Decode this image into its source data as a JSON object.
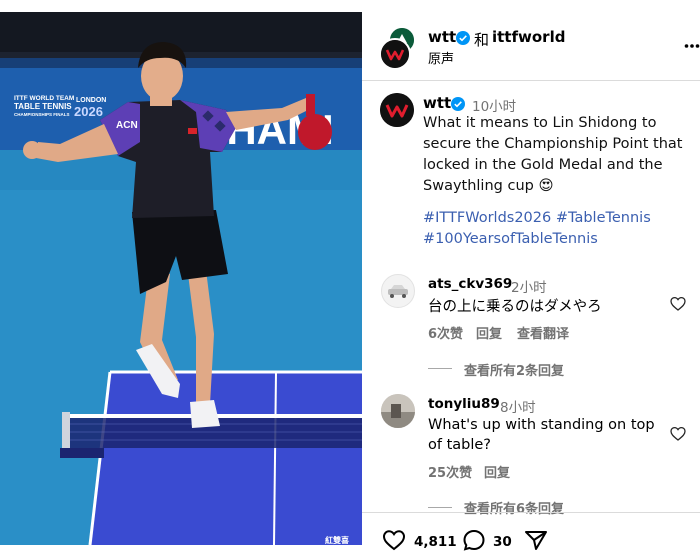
{
  "photo": {
    "banner_small_text": "ITTF WORLD TEAM\nTABLE TENNIS\nCHAMPIONSHIPS FINALS",
    "banner_city": "LONDON",
    "banner_year": "2026",
    "banner_big_text": "CHAMI",
    "shirt_text": "ACN",
    "sponsor_text": "紅雙喜"
  },
  "header": {
    "account": "wtt",
    "coauthor_joiner": "和",
    "coauthor": "ittfworld",
    "audio_label": "原声",
    "more_icon": "more-horizontal-icon"
  },
  "post": {
    "author": "wtt",
    "time": "10小时",
    "caption": "What it means to Lin Shidong to secure the Championship Point that locked in the Gold Medal and the Swaythling cup",
    "emoji": "😍",
    "hashtags": "#ITTFWorlds2026 #TableTennis #100YearsofTableTennis"
  },
  "comments": [
    {
      "user": "ats_ckv369",
      "time": "2小时",
      "text": "台の上に乗るのはダメやろ",
      "likes": "6次赞",
      "reply": "回复",
      "translate": "查看翻译",
      "view_replies": "查看所有2条回复"
    },
    {
      "user": "tonyliu89",
      "time": "8小时",
      "text": "What's up with standing on top of table?",
      "likes": "25次赞",
      "reply": "回复",
      "view_replies": "查看所有6条回复"
    }
  ],
  "actions": {
    "like_count": "4,811",
    "comment_count": "30"
  },
  "colors": {
    "link": "#3b5fb0",
    "verified": "#0095f6",
    "muted": "#737373",
    "court": "#2a8fc7",
    "table": "#3a4bd1"
  }
}
